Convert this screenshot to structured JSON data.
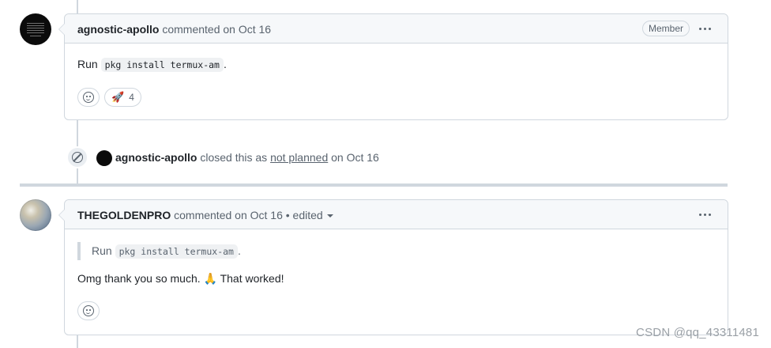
{
  "comment1": {
    "author": "agnostic-apollo",
    "meta": "commented on Oct 16",
    "badge": "Member",
    "body_prefix": "Run",
    "body_code": "pkg install termux-am",
    "body_suffix": ".",
    "reaction_emoji": "🚀",
    "reaction_count": "4"
  },
  "event": {
    "actor": "agnostic-apollo",
    "text_a": "closed this as",
    "reason": "not planned",
    "text_b": "on Oct 16"
  },
  "comment2": {
    "author": "THEGOLDENPRO",
    "meta": "commented on Oct 16 • edited",
    "quote_prefix": "Run",
    "quote_code": "pkg install termux-am",
    "quote_suffix": ".",
    "body": "Omg thank you so much. 🙏 That worked!"
  },
  "watermark": "CSDN @qq_43311481"
}
